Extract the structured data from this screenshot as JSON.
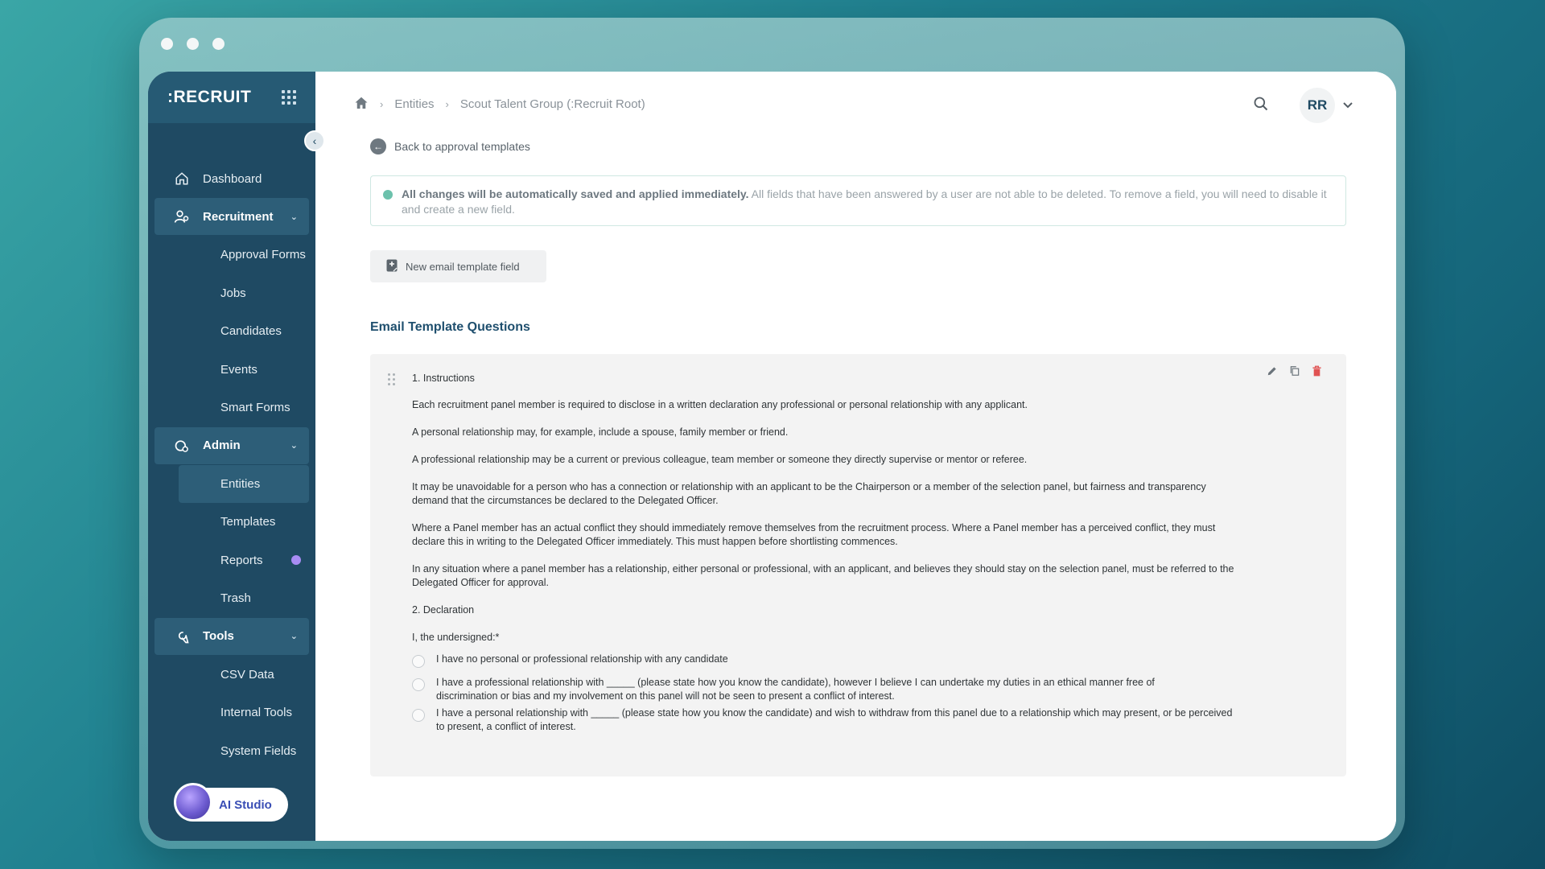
{
  "app": {
    "logo": ":RECRUIT"
  },
  "sidebar": {
    "items": [
      {
        "label": "Dashboard",
        "icon": "home-icon"
      },
      {
        "label": "Recruitment",
        "icon": "user-search-icon",
        "section": true
      },
      {
        "label": "Approval Forms"
      },
      {
        "label": "Jobs"
      },
      {
        "label": "Candidates"
      },
      {
        "label": "Events"
      },
      {
        "label": "Smart Forms"
      },
      {
        "label": "Admin",
        "icon": "admin-icon",
        "section": true
      },
      {
        "label": "Entities",
        "active": true
      },
      {
        "label": "Templates"
      },
      {
        "label": "Reports",
        "badge": true
      },
      {
        "label": "Trash"
      },
      {
        "label": "Tools",
        "icon": "wrench-icon",
        "section": true
      },
      {
        "label": "CSV Data"
      },
      {
        "label": "Internal Tools"
      },
      {
        "label": "System Fields"
      }
    ],
    "ai_studio": "AI Studio"
  },
  "breadcrumb": {
    "entities": "Entities",
    "current": "Scout Talent Group (:Recruit Root)"
  },
  "user": {
    "initials": "RR"
  },
  "main": {
    "back_label": "Back to approval templates",
    "notice_bold": "All changes will be automatically saved and applied immediately.",
    "notice_text": " All fields that have been answered by a user are not able to be deleted. To remove a field, you will need to disable it and create a new field.",
    "new_field_button": "New email template field",
    "section_title": "Email Template Questions",
    "question": {
      "title": "1. Instructions",
      "paragraphs": [
        "Each recruitment panel member is required to disclose in a written declaration any professional or personal relationship with any applicant.",
        "A personal relationship may, for example, include a spouse, family member or friend.",
        "A professional relationship may be a current or previous colleague, team member or someone they directly supervise or mentor or referee.",
        "It may be unavoidable for a person who has a connection or relationship with an applicant to be the Chairperson or a member of the selection panel, but fairness and transparency demand that the circumstances be declared to the Delegated Officer.",
        "Where a Panel member has an actual conflict they should immediately remove themselves from the recruitment process. Where a Panel member has a perceived conflict, they must declare this in writing to the Delegated Officer immediately. This must happen before shortlisting commences.",
        "In any situation where a panel member has a relationship, either personal or professional, with an applicant, and believes they should stay on the selection panel, must be referred to the Delegated Officer for approval."
      ],
      "declaration_title": "2. Declaration",
      "undersigned": "I, the undersigned:*",
      "options": [
        "I have no personal or professional relationship with any candidate",
        "I have a professional relationship with _____ (please state how you know the candidate), however I believe I can undertake my duties in an ethical manner free of discrimination or bias and my involvement on this panel will not be seen to present a conflict of interest.",
        "I have a personal relationship with _____ (please state how you know the candidate) and wish to withdraw from this panel due to a relationship which may present, or be perceived to present, a conflict of interest."
      ]
    }
  },
  "colors": {
    "sidebar": "#1f4a63",
    "accent": "#1f4f6e",
    "badge": "#a88cf3",
    "delete": "#e05252"
  }
}
